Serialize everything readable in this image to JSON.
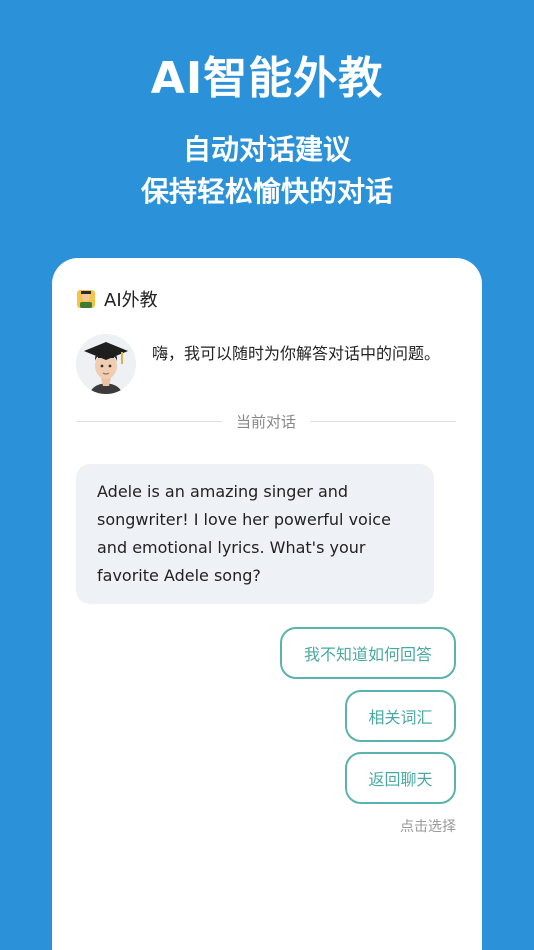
{
  "hero": {
    "title": "AI智能外教",
    "subtitle_line1": "自动对话建议",
    "subtitle_line2": "保持轻松愉快的对话"
  },
  "card": {
    "header_title": "AI外教",
    "header_icon": "teacher-icon",
    "greeting": "嗨，我可以随时为你解答对话中的问题。",
    "divider_label": "当前对话",
    "ai_message": "Adele is an amazing singer and songwriter! I love her powerful voice and emotional lyrics. What's your favorite Adele song?",
    "suggestions": [
      {
        "label": "我不知道如何回答"
      },
      {
        "label": "相关词汇"
      },
      {
        "label": "返回聊天"
      }
    ],
    "hint": "点击选择"
  },
  "colors": {
    "background": "#2b92d9",
    "card": "#ffffff",
    "bubble": "#eef1f5",
    "chip_border": "#5bb3ad",
    "chip_text": "#4aa9a3"
  }
}
